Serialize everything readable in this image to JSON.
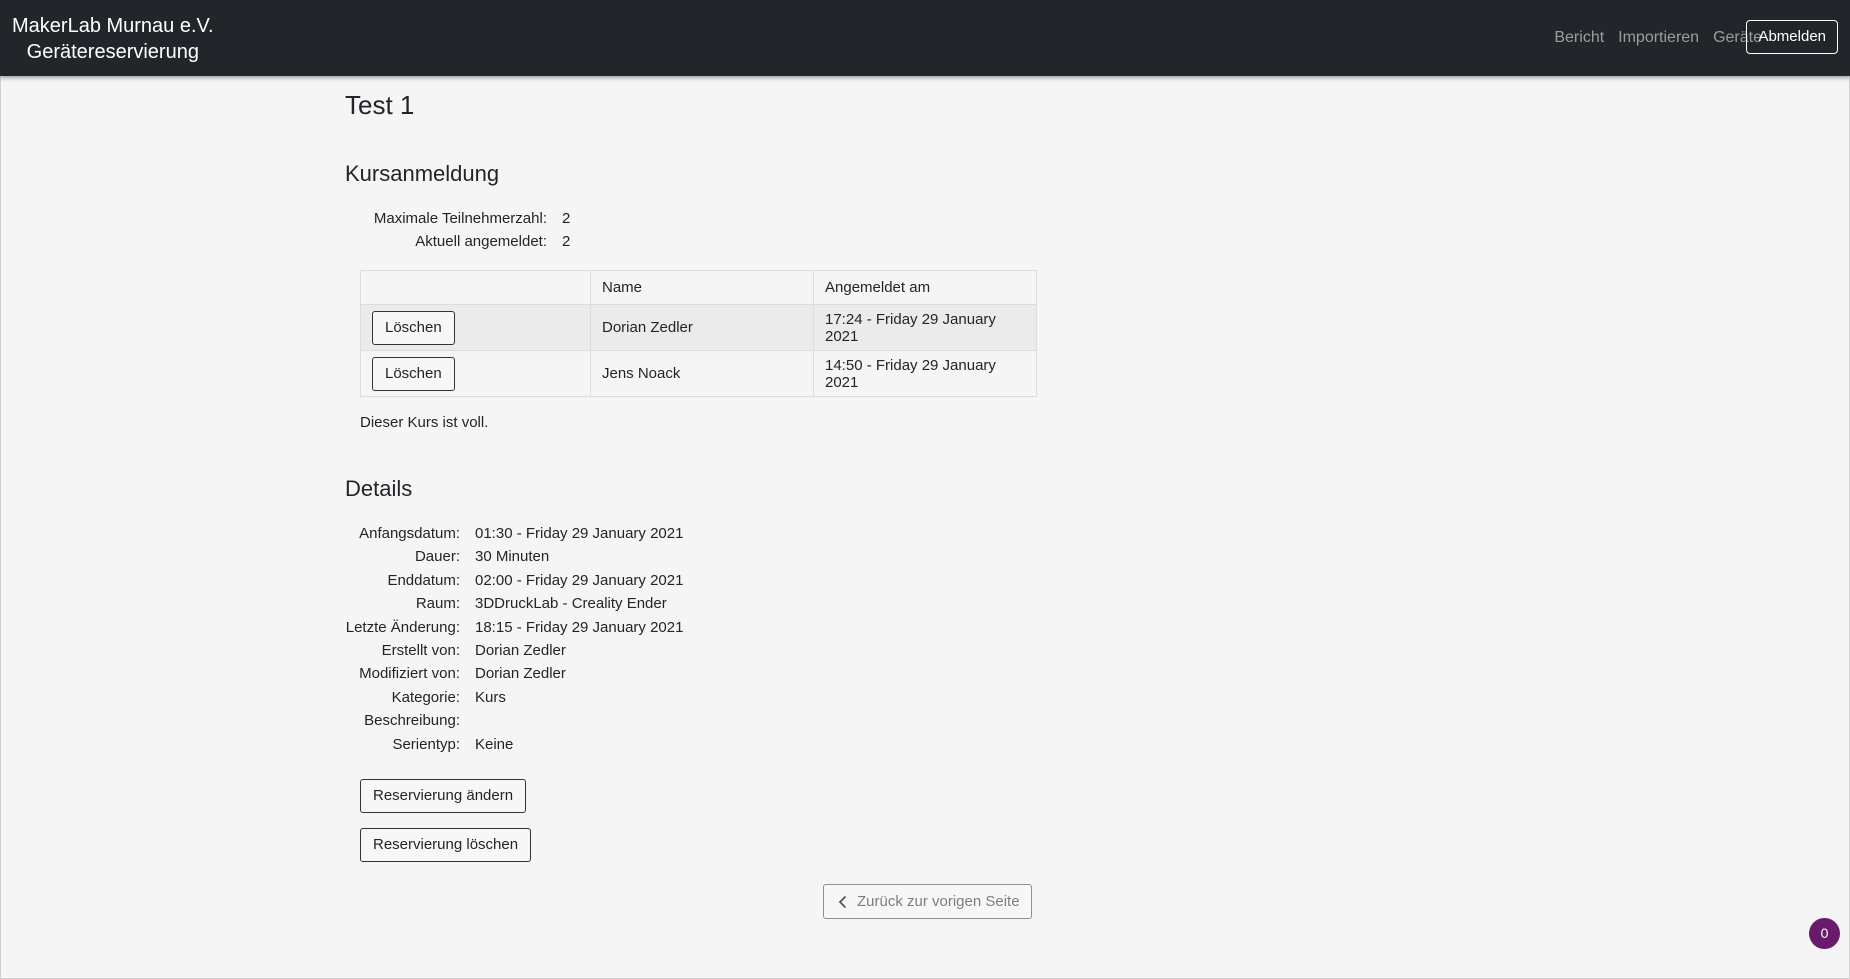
{
  "navbar": {
    "brand_line1": "MakerLab Murnau e.V.",
    "brand_line2": "Gerätereservierung",
    "links": [
      "Bericht",
      "Importieren",
      "Geräte"
    ],
    "logout_label": "Abmelden"
  },
  "page": {
    "title": "Test 1"
  },
  "registration": {
    "heading": "Kursanmeldung",
    "max_label": "Maximale Teilnehmerzahl:",
    "max_value": "2",
    "current_label": "Aktuell angemeldet:",
    "current_value": "2",
    "columns": [
      "",
      "Name",
      "Angemeldet am"
    ],
    "rows": [
      {
        "action": "Löschen",
        "name": "Dorian Zedler",
        "date": "17:24 - Friday 29 January 2021"
      },
      {
        "action": "Löschen",
        "name": "Jens Noack",
        "date": "14:50 - Friday 29 January 2021"
      }
    ],
    "status": "Dieser Kurs ist voll."
  },
  "details": {
    "heading": "Details",
    "fields": [
      {
        "label": "Anfangsdatum:",
        "value": "01:30 - Friday 29 January 2021"
      },
      {
        "label": "Dauer:",
        "value": "30 Minuten"
      },
      {
        "label": "Enddatum:",
        "value": "02:00 - Friday 29 January 2021"
      },
      {
        "label": "Raum:",
        "value": "3DDruckLab - Creality Ender"
      },
      {
        "label": "Letzte Änderung:",
        "value": "18:15 - Friday 29 January 2021"
      },
      {
        "label": "Erstellt von:",
        "value": "Dorian Zedler"
      },
      {
        "label": "Modifiziert von:",
        "value": "Dorian Zedler"
      },
      {
        "label": "Kategorie:",
        "value": "Kurs"
      },
      {
        "label": "Beschreibung:",
        "value": ""
      },
      {
        "label": "Serientyp:",
        "value": "Keine"
      }
    ]
  },
  "actions": {
    "edit_label": "Reservierung ändern",
    "delete_label": "Reservierung löschen",
    "back_label": "Zurück zur vorigen Seite"
  },
  "badge": {
    "count": "0",
    "color": "#6a1a6b"
  }
}
